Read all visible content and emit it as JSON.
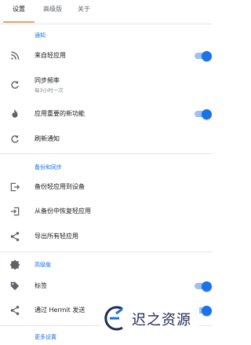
{
  "tabs": [
    {
      "label": "设置",
      "active": true
    },
    {
      "label": "高级版",
      "active": false
    },
    {
      "label": "关于",
      "active": false
    }
  ],
  "sections": {
    "notifications": {
      "title": "通知",
      "items": [
        {
          "label": "来自轻应用",
          "icon": "rss-icon",
          "toggle": true
        },
        {
          "label": "同步频率",
          "sub": "每3小时一次",
          "icon": "refresh-icon"
        },
        {
          "label": "应用重要的新功能",
          "icon": "flame-icon",
          "toggle": true
        },
        {
          "label": "刷新通知",
          "icon": "refresh-icon"
        }
      ]
    },
    "backup": {
      "title": "备份和同步",
      "items": [
        {
          "label": "备份轻应用到设备",
          "icon": "export-icon"
        },
        {
          "label": "从备份中恢复轻应用",
          "icon": "import-icon"
        },
        {
          "label": "导出所有轻应用",
          "icon": "share-icon"
        }
      ]
    },
    "premium": {
      "title": "高级版",
      "items": [
        {
          "label": "标签",
          "icon": "tag-icon",
          "toggle": true
        },
        {
          "label": "通过 Hermit 发送",
          "icon": "share-icon",
          "toggle": true
        }
      ]
    },
    "more": {
      "title": "更多设置"
    }
  },
  "colors": {
    "accent": "#1a73e8",
    "tab_indicator": "#e5a06e",
    "toggle_track": "#9cc1f5"
  },
  "watermark": {
    "text": "迟之资源"
  }
}
